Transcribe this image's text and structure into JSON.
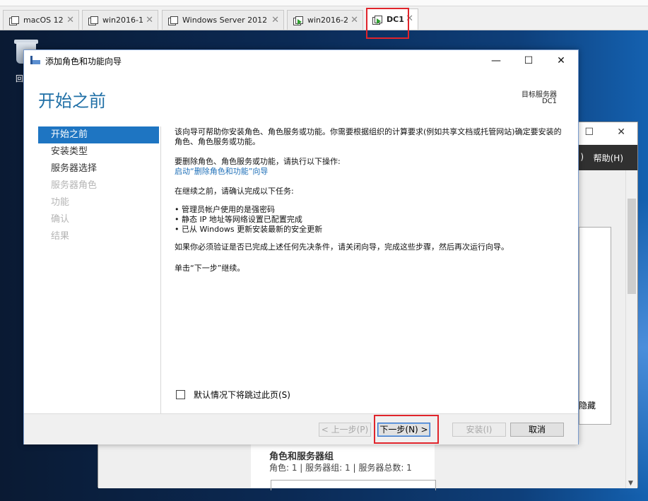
{
  "tabs": [
    {
      "label": "macOS 12"
    },
    {
      "label": "win2016-1"
    },
    {
      "label": "Windows Server 2012"
    },
    {
      "label": "win2016-2"
    },
    {
      "label": "DC1"
    }
  ],
  "desktop": {
    "recycle_label": "回"
  },
  "background_window": {
    "minimize": "",
    "maximize": "☐",
    "close": "✕",
    "menu_paren": ")",
    "help_menu": "帮助(H)",
    "hide_text": "隐藏",
    "roles_title": "角色和服务器组",
    "roles_summary": "角色: 1 | 服务器组: 1 | 服务器总数: 1"
  },
  "wizard": {
    "window_title": "添加角色和功能向导",
    "minimize": "—",
    "maximize": "☐",
    "close": "✕",
    "page_title": "开始之前",
    "target_server_label": "目标服务器",
    "target_server_value": "DC1",
    "nav": [
      {
        "label": "开始之前",
        "state": "active"
      },
      {
        "label": "安装类型",
        "state": "enabled"
      },
      {
        "label": "服务器选择",
        "state": "enabled"
      },
      {
        "label": "服务器角色",
        "state": "disabled"
      },
      {
        "label": "功能",
        "state": "disabled"
      },
      {
        "label": "确认",
        "state": "disabled"
      },
      {
        "label": "结果",
        "state": "disabled"
      }
    ],
    "intro": "该向导可帮助你安装角色、角色服务或功能。你需要根据组织的计算要求(例如共享文档或托管网站)确定要安装的角色、角色服务或功能。",
    "remove_prompt": "要删除角色、角色服务或功能，请执行以下操作:",
    "remove_link": "启动“删除角色和功能”向导",
    "confirm_prompt": "在继续之前，请确认完成以下任务:",
    "tasks": [
      "管理员帐户使用的是强密码",
      "静态 IP 地址等网络设置已配置完成",
      "已从 Windows 更新安装最新的安全更新"
    ],
    "verify_text": "如果你必须验证是否已完成上述任何先决条件，请关闭向导，完成这些步骤，然后再次运行向导。",
    "click_next": "单击“下一步”继续。",
    "skip_checkbox": "默认情况下将跳过此页(S)",
    "buttons": {
      "previous": "< 上一步(P)",
      "next": "下一步(N) >",
      "install": "安装(I)",
      "cancel": "取消"
    }
  }
}
